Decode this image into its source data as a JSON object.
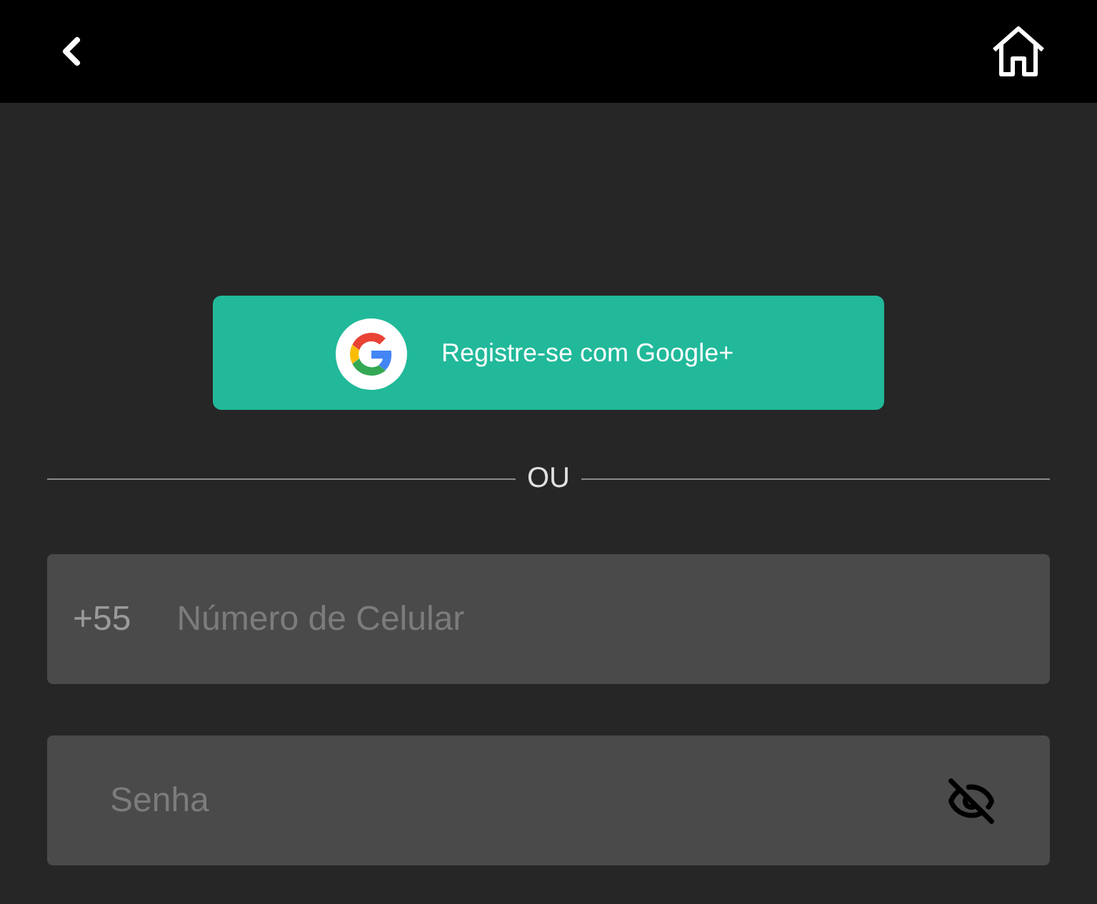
{
  "google_button": {
    "label": "Registre-se com Google+"
  },
  "divider": {
    "label": "OU"
  },
  "phone_field": {
    "prefix": "+55",
    "placeholder": "Número de Celular"
  },
  "password_field": {
    "placeholder": "Senha",
    "visible": false
  }
}
